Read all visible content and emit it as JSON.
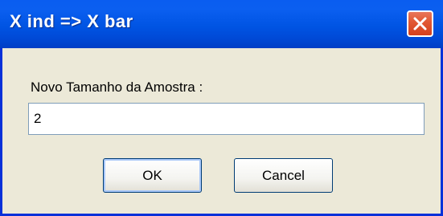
{
  "window": {
    "title": "X ind => X bar"
  },
  "icons": {
    "close": "close-icon"
  },
  "dialog": {
    "label": "Novo Tamanho da Amostra :",
    "input_value": "2"
  },
  "buttons": {
    "ok_label": "OK",
    "cancel_label": "Cancel"
  },
  "colors": {
    "titlebar": "#0054e3",
    "close_button": "#e25a35",
    "dialog_background": "#ece9d8",
    "input_border": "#7f9db9"
  }
}
